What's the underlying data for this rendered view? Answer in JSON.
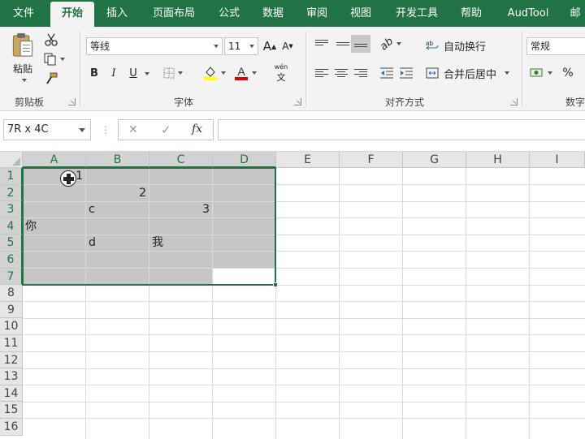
{
  "tabs": [
    "文件",
    "开始",
    "插入",
    "页面布局",
    "公式",
    "数据",
    "审阅",
    "视图",
    "开发工具",
    "帮助",
    "AudTool",
    "邮"
  ],
  "active_tab": "开始",
  "ribbon": {
    "clipboard": {
      "label": "剪贴板",
      "paste_label": "粘贴"
    },
    "font": {
      "label": "字体",
      "name": "等线",
      "size": "11",
      "bold": "B",
      "italic": "I",
      "underline": "U",
      "grow": "A",
      "shrink": "A",
      "phonetic": "wén"
    },
    "alignment": {
      "label": "对齐方式",
      "wrap_text": "自动换行",
      "merge_center": "合并后居中"
    },
    "number": {
      "label": "数字",
      "format": "常规",
      "percent": "%"
    }
  },
  "formula_bar": {
    "name_box": "7R x 4C",
    "fx": "fx",
    "cancel": "✕",
    "enter": "✓",
    "formula": ""
  },
  "grid": {
    "columns": [
      "A",
      "B",
      "C",
      "D",
      "E",
      "F",
      "G",
      "H",
      "I"
    ],
    "rows": [
      "1",
      "2",
      "3",
      "4",
      "5",
      "6",
      "7",
      "8",
      "9",
      "10",
      "11",
      "12",
      "13",
      "14",
      "15",
      "16"
    ],
    "cells": {
      "A1": "1",
      "B2": "2",
      "B3": "c",
      "C3": "3",
      "A4": "你",
      "B5": "d",
      "C5": "我"
    }
  },
  "colors": {
    "accent": "#217346",
    "selection": "#c6c6c6",
    "font_color": "#e00000",
    "fill_color": "#ffff00"
  }
}
